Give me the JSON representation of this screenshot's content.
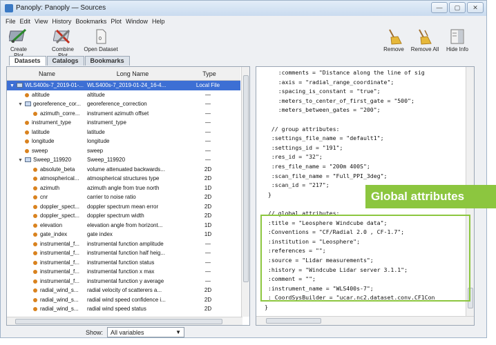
{
  "window": {
    "title": "Panoply: Panoply — Sources",
    "controls": [
      "—",
      "▢",
      "✕"
    ]
  },
  "menu": [
    "File",
    "Edit",
    "View",
    "History",
    "Bookmarks",
    "Plot",
    "Window",
    "Help"
  ],
  "toolbar": {
    "create_plot": "Create Plot",
    "combine_plot": "Combine Plot",
    "open_dataset": "Open Dataset",
    "remove": "Remove",
    "remove_all": "Remove All",
    "hide_info": "Hide Info"
  },
  "tabs": [
    "Datasets",
    "Catalogs",
    "Bookmarks"
  ],
  "table": {
    "headers": [
      "Name",
      "Long Name",
      "Type"
    ],
    "rows": [
      {
        "name": "WLS400s-7_2019-01-...",
        "long": "WLS400s-7_2019-01-24_16-4...",
        "type": "Local File",
        "kind": "file",
        "indent": 0,
        "tri": "▼"
      },
      {
        "name": "altitude",
        "long": "altitude",
        "type": "—",
        "kind": "var",
        "indent": 1,
        "tri": ""
      },
      {
        "name": "georeference_cor...",
        "long": "georeference_correction",
        "type": "—",
        "kind": "group",
        "indent": 1,
        "tri": "▼"
      },
      {
        "name": "azimuth_corre...",
        "long": "instrument azimuth offset",
        "type": "—",
        "kind": "var",
        "indent": 2,
        "tri": ""
      },
      {
        "name": "instrument_type",
        "long": "instrument_type",
        "type": "—",
        "kind": "var",
        "indent": 1,
        "tri": ""
      },
      {
        "name": "latitude",
        "long": "latitude",
        "type": "—",
        "kind": "var",
        "indent": 1,
        "tri": ""
      },
      {
        "name": "longitude",
        "long": "longitude",
        "type": "—",
        "kind": "var",
        "indent": 1,
        "tri": ""
      },
      {
        "name": "sweep",
        "long": "sweep",
        "type": "—",
        "kind": "var",
        "indent": 1,
        "tri": ""
      },
      {
        "name": "Sweep_119920",
        "long": "Sweep_119920",
        "type": "—",
        "kind": "group",
        "indent": 1,
        "tri": "▼"
      },
      {
        "name": "absolute_beta",
        "long": "volume attenuated backwards...",
        "type": "2D",
        "kind": "var",
        "indent": 2,
        "tri": ""
      },
      {
        "name": "atmospherical...",
        "long": "atmospherical structures type",
        "type": "2D",
        "kind": "var",
        "indent": 2,
        "tri": ""
      },
      {
        "name": "azimuth",
        "long": "azimuth angle from true north",
        "type": "1D",
        "kind": "var",
        "indent": 2,
        "tri": ""
      },
      {
        "name": "cnr",
        "long": "carrier to noise ratio",
        "type": "2D",
        "kind": "var",
        "indent": 2,
        "tri": ""
      },
      {
        "name": "doppler_spect...",
        "long": "doppler spectrum mean error",
        "type": "2D",
        "kind": "var",
        "indent": 2,
        "tri": ""
      },
      {
        "name": "doppler_spect...",
        "long": "doppler spectrum width",
        "type": "2D",
        "kind": "var",
        "indent": 2,
        "tri": ""
      },
      {
        "name": "elevation",
        "long": "elevation angle from horizont...",
        "type": "1D",
        "kind": "var",
        "indent": 2,
        "tri": ""
      },
      {
        "name": "gate_index",
        "long": "gate index",
        "type": "1D",
        "kind": "var",
        "indent": 2,
        "tri": ""
      },
      {
        "name": "instrumental_f...",
        "long": "instrumental function amplitude",
        "type": "—",
        "kind": "var",
        "indent": 2,
        "tri": ""
      },
      {
        "name": "instrumental_f...",
        "long": "instrumental function half heig...",
        "type": "—",
        "kind": "var",
        "indent": 2,
        "tri": ""
      },
      {
        "name": "instrumental_f...",
        "long": "instrumental function status",
        "type": "—",
        "kind": "var",
        "indent": 2,
        "tri": ""
      },
      {
        "name": "instrumental_f...",
        "long": "instrumental function x max",
        "type": "—",
        "kind": "var",
        "indent": 2,
        "tri": ""
      },
      {
        "name": "instrumental_f...",
        "long": "instrumental function y average",
        "type": "—",
        "kind": "var",
        "indent": 2,
        "tri": ""
      },
      {
        "name": "radial_wind_s...",
        "long": "radial velocity of scatterers a...",
        "type": "2D",
        "kind": "var",
        "indent": 2,
        "tri": ""
      },
      {
        "name": "radial_wind_s...",
        "long": "radial wind speed confidence i...",
        "type": "2D",
        "kind": "var",
        "indent": 2,
        "tri": ""
      },
      {
        "name": "radial_wind_s...",
        "long": "radial wind speed status",
        "type": "2D",
        "kind": "var",
        "indent": 2,
        "tri": ""
      }
    ]
  },
  "show": {
    "label": "Show:",
    "value": "All variables"
  },
  "code_lines": [
    "    :comments = \"Distance along the line of sig",
    "    :axis = \"radial_range_coordinate\";",
    "    :spacing_is_constant = \"true\";",
    "    :meters_to_center_of_first_gate = \"500\";",
    "    :meters_between_gates = \"200\";",
    "",
    "  // group attributes:",
    "  :settings_file_name = \"default1\";",
    "  :settings_id = \"191\";",
    "  :res_id = \"32\";",
    "  :res_file_name = \"200m 400S\";",
    "  :scan_file_name = \"Full_PPI_3deg\";",
    "  :scan_id = \"217\";",
    " }",
    "",
    " // global attributes:",
    " :title = \"Leosphere Windcube data\";",
    " :Conventions = \"CF/Radial 2.0 , CF-1.7\";",
    " :institution = \"Leosphere\";",
    " :references = \"\";",
    " :source = \"Lidar measurements\";",
    " :history = \"Windcube Lidar server 3.1.1\";",
    " :comment = \"\";",
    " :instrument_name = \"WLS400s-7\";",
    " :_CoordSysBuilder = \"ucar.nc2.dataset.conv.CF1Con",
    "}"
  ],
  "callout": "Global attributes",
  "colors": {
    "accent_green": "#8cc63f",
    "selection_blue": "#3d6fd4"
  }
}
